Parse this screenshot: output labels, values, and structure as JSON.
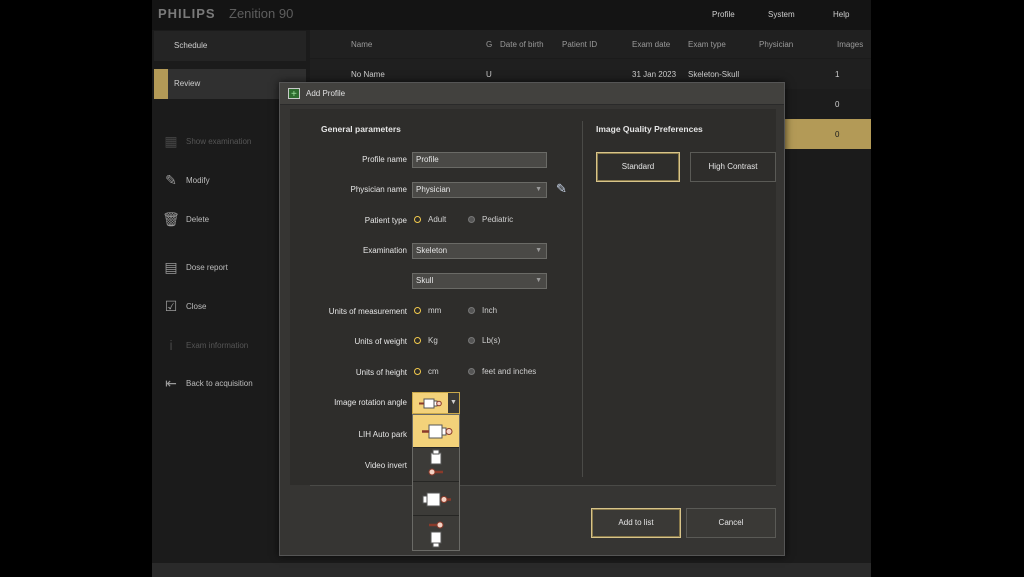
{
  "app": {
    "brand": "PHILIPS",
    "model": "Zenition 90"
  },
  "topmenu": [
    "Profile",
    "System",
    "Help"
  ],
  "nav": {
    "schedule": "Schedule",
    "review": "Review"
  },
  "actions": [
    {
      "label": "Show examination",
      "icon": "examination-icon",
      "enabled": false
    },
    {
      "label": "Modify",
      "icon": "pencil-icon",
      "enabled": true
    },
    {
      "label": "Delete",
      "icon": "trash-icon",
      "enabled": true
    },
    {
      "label": "Dose report",
      "icon": "report-icon",
      "enabled": true
    },
    {
      "label": "Close",
      "icon": "close-exam-icon",
      "enabled": true
    },
    {
      "label": "Exam information",
      "icon": "info-icon",
      "enabled": false
    },
    {
      "label": "Back to acquisition",
      "icon": "back-icon",
      "enabled": true
    }
  ],
  "table": {
    "columns": [
      "Name",
      "G",
      "Date of birth",
      "Patient ID",
      "Exam date",
      "Exam type",
      "Physician",
      "Images"
    ],
    "rows": [
      {
        "name": "No Name",
        "g": "U",
        "exam_date": "31 Jan 2023",
        "exam_type": "Skeleton-Skull",
        "images": "1"
      },
      {
        "images": "0"
      },
      {
        "images": "0"
      }
    ]
  },
  "dialog": {
    "title": "Add Profile",
    "general_heading": "General parameters",
    "iq_heading": "Image Quality Preferences",
    "labels": {
      "profile_name": "Profile name",
      "physician_name": "Physician name",
      "patient_type": "Patient type",
      "examination": "Examination",
      "units_measurement": "Units of measurement",
      "units_weight": "Units of weight",
      "units_height": "Units of height",
      "rotation": "Image rotation angle",
      "lih_auto_park": "LIH Auto park",
      "video_invert": "Video invert"
    },
    "values": {
      "profile_name": "Profile",
      "physician": "Physician",
      "examination": "Skeleton",
      "examination_sub": "Skull"
    },
    "radios": {
      "patient_type": [
        "Adult",
        "Pediatric"
      ],
      "measurement": [
        "mm",
        "Inch"
      ],
      "weight": [
        "Kg",
        "Lb(s)"
      ],
      "height": [
        "cm",
        "feet and inches"
      ]
    },
    "iq_buttons": {
      "standard": "Standard",
      "high_contrast": "High Contrast"
    },
    "buttons": {
      "add": "Add to list",
      "cancel": "Cancel"
    }
  }
}
